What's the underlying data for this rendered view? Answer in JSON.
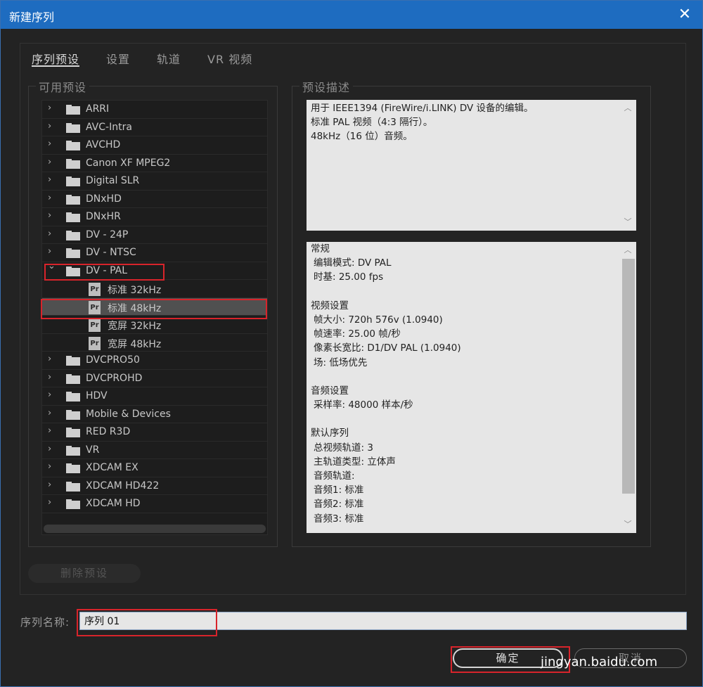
{
  "window": {
    "title": "新建序列",
    "close_glyph": "✕"
  },
  "tabs": [
    {
      "label": "序列预设",
      "active": true
    },
    {
      "label": "设置",
      "active": false
    },
    {
      "label": "轨道",
      "active": false
    },
    {
      "label": "VR 视频",
      "active": false
    }
  ],
  "presets": {
    "legend": "可用预设",
    "items": [
      {
        "label": "ARRI",
        "type": "folder"
      },
      {
        "label": "AVC-Intra",
        "type": "folder"
      },
      {
        "label": "AVCHD",
        "type": "folder"
      },
      {
        "label": "Canon XF MPEG2",
        "type": "folder"
      },
      {
        "label": "Digital SLR",
        "type": "folder"
      },
      {
        "label": "DNxHD",
        "type": "folder"
      },
      {
        "label": "DNxHR",
        "type": "folder"
      },
      {
        "label": "DV - 24P",
        "type": "folder"
      },
      {
        "label": "DV - NTSC",
        "type": "folder"
      },
      {
        "label": "DV - PAL",
        "type": "folder",
        "expanded": true
      },
      {
        "label": "标准 32kHz",
        "type": "preset"
      },
      {
        "label": "标准 48kHz",
        "type": "preset",
        "selected": true
      },
      {
        "label": "宽屏 32kHz",
        "type": "preset"
      },
      {
        "label": "宽屏 48kHz",
        "type": "preset"
      },
      {
        "label": "DVCPRO50",
        "type": "folder"
      },
      {
        "label": "DVCPROHD",
        "type": "folder"
      },
      {
        "label": "HDV",
        "type": "folder"
      },
      {
        "label": "Mobile & Devices",
        "type": "folder"
      },
      {
        "label": "RED R3D",
        "type": "folder"
      },
      {
        "label": "VR",
        "type": "folder"
      },
      {
        "label": "XDCAM EX",
        "type": "folder"
      },
      {
        "label": "XDCAM HD422",
        "type": "folder"
      },
      {
        "label": "XDCAM HD",
        "type": "folder"
      }
    ]
  },
  "description": {
    "legend": "预设描述",
    "lines": [
      "用于 IEEE1394 (FireWire/i.LINK) DV 设备的编辑。",
      "标准 PAL 视频（4:3 隔行）。",
      "48kHz（16 位）音频。"
    ]
  },
  "info": {
    "lines": [
      {
        "text": "常规",
        "sub": false
      },
      {
        "text": "编辑模式: DV PAL",
        "sub": true
      },
      {
        "text": "时基: 25.00 fps",
        "sub": true
      },
      {
        "text": "",
        "sub": false
      },
      {
        "text": "视频设置",
        "sub": false
      },
      {
        "text": "帧大小: 720h 576v (1.0940)",
        "sub": true
      },
      {
        "text": "帧速率: 25.00  帧/秒",
        "sub": true
      },
      {
        "text": "像素长宽比: D1/DV PAL (1.0940)",
        "sub": true
      },
      {
        "text": "场: 低场优先",
        "sub": true
      },
      {
        "text": "",
        "sub": false
      },
      {
        "text": "音频设置",
        "sub": false
      },
      {
        "text": "采样率: 48000 样本/秒",
        "sub": true
      },
      {
        "text": "",
        "sub": false
      },
      {
        "text": "默认序列",
        "sub": false
      },
      {
        "text": "总视频轨道: 3",
        "sub": true
      },
      {
        "text": "主轨道类型: 立体声",
        "sub": true
      },
      {
        "text": "音频轨道:",
        "sub": true
      },
      {
        "text": "音频1: 标准",
        "sub": true
      },
      {
        "text": "音频2: 标准",
        "sub": true
      },
      {
        "text": "音频3: 标准",
        "sub": true
      }
    ]
  },
  "buttons": {
    "delete_preset": "删除预设",
    "ok": "确定",
    "cancel": "取消"
  },
  "sequence_name": {
    "label": "序列名称:",
    "value": "序列 01"
  },
  "watermark": {
    "text": "jingyan.baidu.com"
  },
  "colors": {
    "titlebar": "#1e6cc0",
    "highlight": "#d8242b",
    "selected_row": "#505050"
  }
}
